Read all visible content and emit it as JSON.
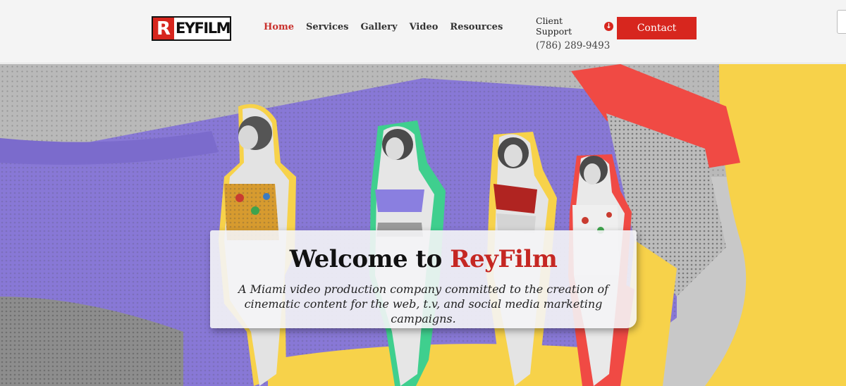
{
  "logo": {
    "mark": "R",
    "text": "EYFILM"
  },
  "nav": [
    {
      "label": "Home"
    },
    {
      "label": "Services"
    },
    {
      "label": "Gallery"
    },
    {
      "label": "Video"
    },
    {
      "label": "Resources"
    }
  ],
  "support": {
    "label": "Client Support",
    "phone": "(786) 289-9493"
  },
  "contact": {
    "label": "Contact"
  },
  "hero": {
    "title_prefix": "Welcome to ",
    "title_brand": "ReyFilm",
    "subtitle": "A Miami video production company committed to the creation of cinematic content for the web, t.v, and social media marketing campaigns."
  },
  "colors": {
    "brand_red": "#d7261e",
    "lavender": "#8878d6",
    "yellow": "#f7d24a",
    "green": "#3fcf8e",
    "coral": "#f04a44"
  }
}
